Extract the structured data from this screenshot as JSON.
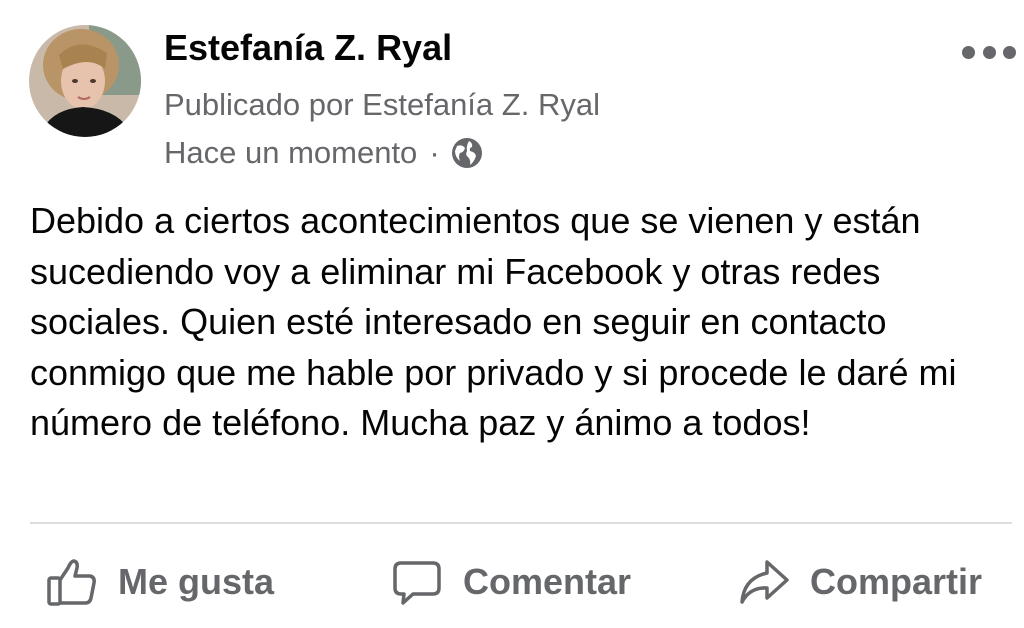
{
  "post": {
    "author": "Estefanía Z. Ryal",
    "published_by": "Publicado por Estefanía Z. Ryal",
    "timestamp": "Hace un momento",
    "separator": "·",
    "audience_icon": "globe-icon",
    "more_icon": "more-options-icon",
    "body": "Debido a ciertos acontecimientos que se vienen y están sucediendo voy a eliminar mi Facebook y otras redes sociales. Quien esté interesado en seguir en contacto conmigo que me hable por privado y si procede le daré mi número de teléfono. Mucha paz y ánimo a todos!"
  },
  "actions": {
    "like": {
      "label": "Me gusta",
      "icon": "thumbs-up-icon"
    },
    "comment": {
      "label": "Comentar",
      "icon": "comment-bubble-icon"
    },
    "share": {
      "label": "Compartir",
      "icon": "share-arrow-icon"
    }
  },
  "colors": {
    "text_primary": "#050505",
    "text_secondary": "#65676b",
    "divider": "#dcdde0"
  }
}
